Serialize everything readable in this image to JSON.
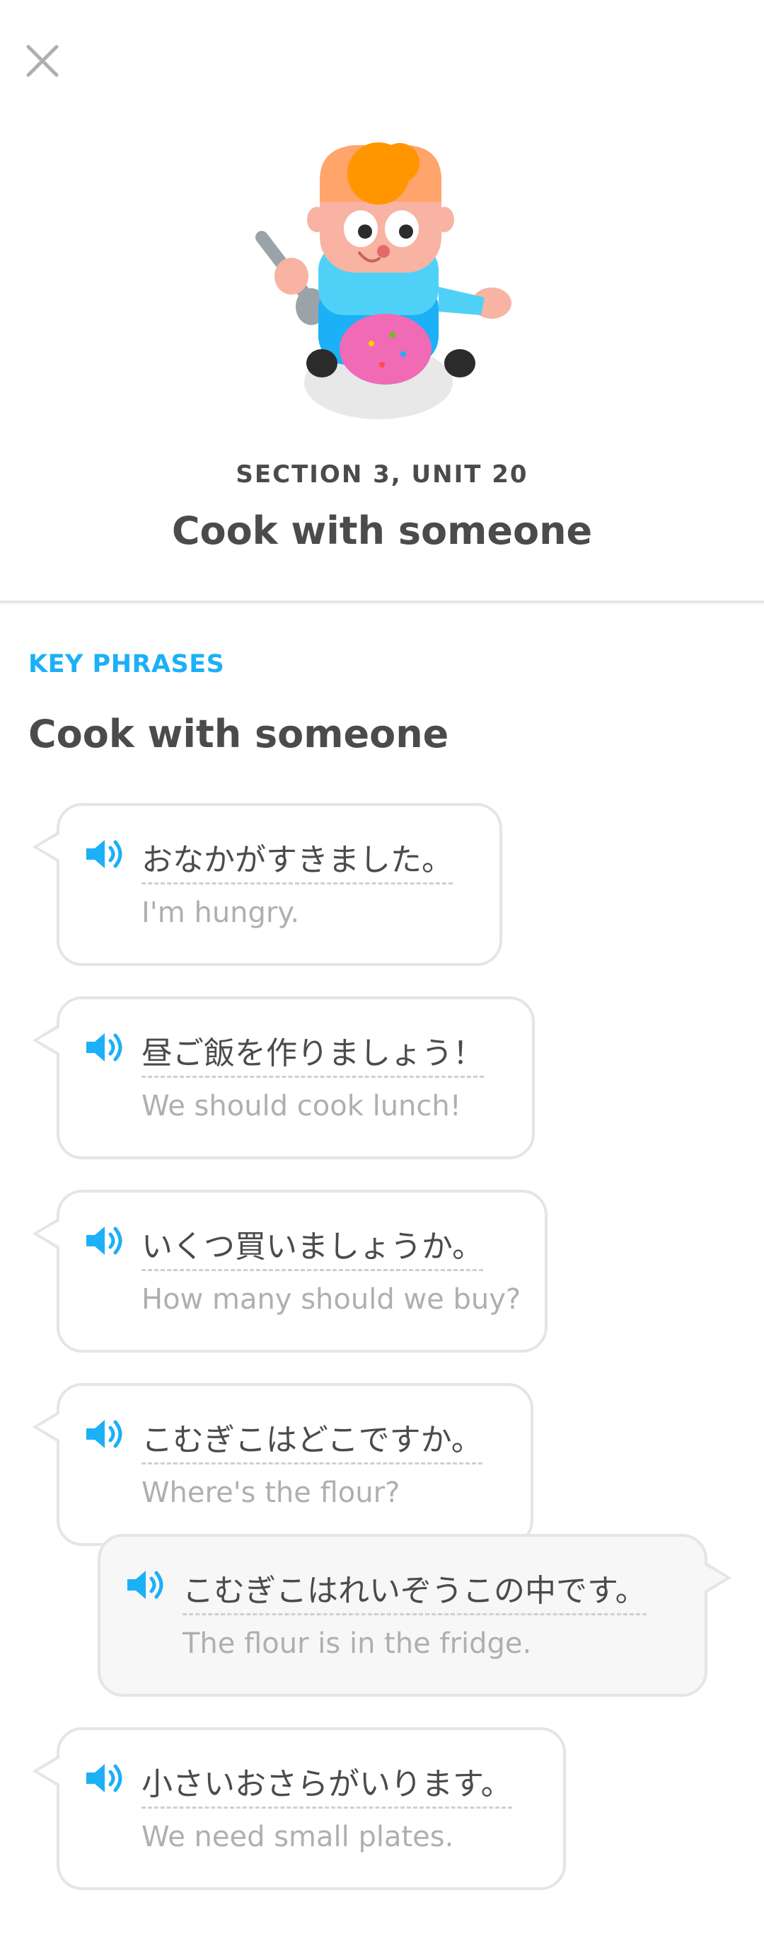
{
  "header": {
    "close_icon": "close-icon",
    "section_label": "SECTION 3, UNIT 20",
    "unit_title": "Cook with someone"
  },
  "content": {
    "key_label": "KEY PHRASES",
    "title": "Cook with someone"
  },
  "phrases": [
    {
      "jp": "おなかがすきました。",
      "en": "I'm hungry.",
      "side": "left"
    },
    {
      "jp": "昼ご飯を作りましょう！",
      "en": "We should cook lunch!",
      "side": "left"
    },
    {
      "jp": "いくつ買いましょうか。",
      "en": "How many should we buy?",
      "side": "left"
    },
    {
      "jp": "こむぎこはどこですか。",
      "en": "Where's the flour?",
      "side": "left"
    },
    {
      "jp": "こむぎこはれいぞうこの中です。",
      "en": "The flour is in the fridge.",
      "side": "right"
    },
    {
      "jp": "小さいおさらがいります。",
      "en": "We need small plates.",
      "side": "left"
    }
  ],
  "colors": {
    "accent": "#1cb0f6",
    "text": "#4b4b4b",
    "muted": "#afafaf",
    "border": "#e5e5e5"
  },
  "icons": {
    "speaker": "speaker-icon",
    "character": "character-illustration"
  }
}
